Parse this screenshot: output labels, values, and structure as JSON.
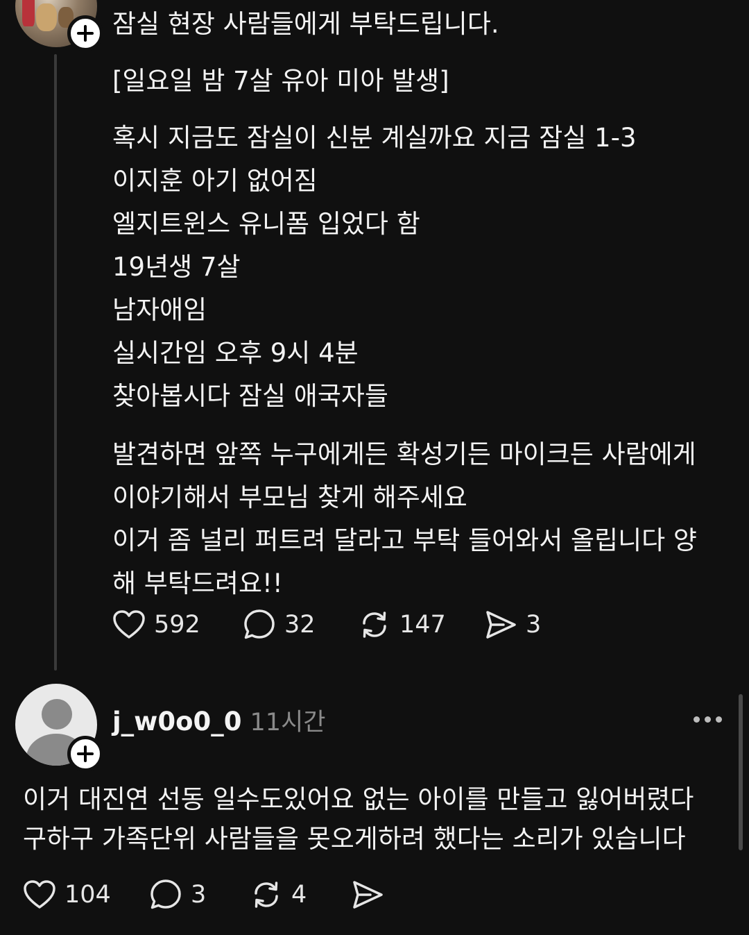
{
  "post": {
    "lines": [
      "잠실 현장 사람들에게 부탁드립니다.",
      "[일요일 밤 7살 유아 미아 발생]",
      "혹시 지금도 잠실이 신분 계실까요 지금 잠실 1-3",
      "이지훈 아기 없어짐",
      "엘지트윈스 유니폼 입었다 함",
      "19년생 7살",
      "남자애임",
      "실시간임 오후 9시 4분",
      "찾아봅시다 잠실 애국자들",
      "발견하면 앞쪽 누구에게든 확성기든 마이크든 사람에게",
      "이야기해서 부모님 찾게 해주세요",
      "이거 좀 널리 퍼트려 달라고 부탁 들어와서 올립니다 양",
      "해 부탁드려요!!"
    ],
    "likes": "592",
    "replies": "32",
    "reposts": "147",
    "shares": "3"
  },
  "reply": {
    "username": "j_w0o0_0",
    "time": "11시간",
    "lines": [
      "이거 대진연 선동 일수도있어요 없는 아이를 만들고 잃어버렸다",
      "구하구 가족단위 사람들을 못오게하려 했다는 소리가 있습니다"
    ],
    "likes": "104",
    "replies": "3",
    "reposts": "4"
  },
  "icons": {
    "like": "heart-icon",
    "reply": "comment-bubble-icon",
    "repost": "repost-arrows-icon",
    "share": "send-icon",
    "follow": "plus-icon",
    "more": "more-dots-icon"
  },
  "colors": {
    "background": "#101010",
    "text": "#f3f3f3",
    "muted": "#8a8a8a"
  }
}
